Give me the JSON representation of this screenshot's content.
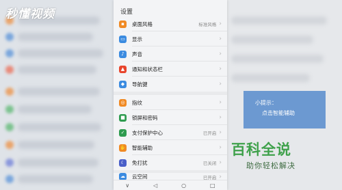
{
  "watermark": {
    "logo_text": "秒懂视频"
  },
  "settings": {
    "title": "设置",
    "items": [
      {
        "label": "桌面风格",
        "value": "标准风格",
        "icon": "desktop-style-icon",
        "color": "#f08a24"
      },
      {
        "label": "显示",
        "value": "",
        "icon": "display-icon",
        "color": "#3b8be0"
      },
      {
        "label": "声音",
        "value": "",
        "icon": "sound-icon",
        "color": "#3b8be0"
      },
      {
        "label": "通知和状态栏",
        "value": "",
        "icon": "notification-icon",
        "color": "#e8452c"
      },
      {
        "label": "导航键",
        "value": "",
        "icon": "navigation-key-icon",
        "color": "#3b8be0"
      },
      {
        "label": "指纹",
        "value": "",
        "icon": "fingerprint-icon",
        "color": "#f08a24"
      },
      {
        "label": "锁屏和密码",
        "value": "",
        "icon": "lock-icon",
        "color": "#2e9b4f"
      },
      {
        "label": "支付保护中心",
        "value": "已开启",
        "icon": "payment-shield-icon",
        "color": "#2e9b4f"
      },
      {
        "label": "智能辅助",
        "value": "",
        "icon": "smart-assist-icon",
        "color": "#f08a24"
      },
      {
        "label": "免打扰",
        "value": "已关闭",
        "icon": "do-not-disturb-icon",
        "color": "#4a5fc9"
      },
      {
        "label": "云空间",
        "value": "已开启",
        "icon": "cloud-icon",
        "color": "#3b8be0"
      }
    ]
  },
  "navbar": {
    "back": "◁",
    "home": "○",
    "recent": "□",
    "down": "∨"
  },
  "tip": {
    "title": "小提示：",
    "body": "点击智能辅助"
  },
  "baike": {
    "title": "百科全说",
    "subtitle": "助你轻松解决"
  }
}
